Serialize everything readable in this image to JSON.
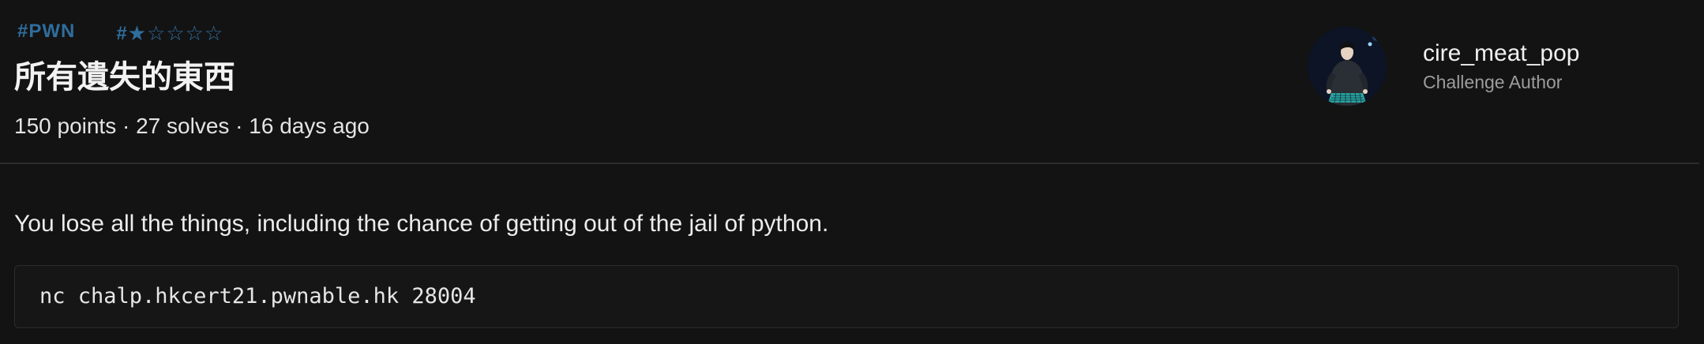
{
  "challenge": {
    "category_tag": "#PWN",
    "difficulty": {
      "prefix": "#",
      "filled_star": "★",
      "empty_star": "☆",
      "rating": 1,
      "max": 5
    },
    "title": "所有遺失的東西",
    "meta": "150 points · 27 solves · 16 days ago",
    "description": "You lose all the things, including the chance of getting out of the jail of python.",
    "code": "nc chalp.hkcert21.pwnable.hk 28004"
  },
  "author": {
    "name": "cire_meat_pop",
    "role": "Challenge Author"
  },
  "colors": {
    "background": "#131313",
    "tag": "#2f6d9c",
    "divider": "#2c2c2c",
    "code_background": "#161616",
    "muted_text": "#9c9c9c"
  }
}
